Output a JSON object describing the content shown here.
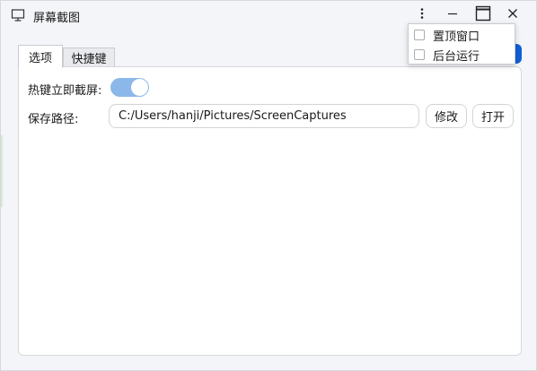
{
  "window": {
    "title": "屏幕截图",
    "app_icon": "monitor-icon"
  },
  "titlebar": {
    "menu_icon": "more-vertical-icon",
    "minimize_icon": "minimize-icon",
    "maximize_icon": "maximize-icon",
    "close_icon": "close-icon"
  },
  "tabs": [
    {
      "label": "选项",
      "active": true
    },
    {
      "label": "快捷键",
      "active": false
    }
  ],
  "options": {
    "hotkey_capture_label": "热键立即截屏:",
    "hotkey_capture_enabled": true,
    "save_path_label": "保存路径:",
    "save_path_value": "C:/Users/hanji/Pictures/ScreenCaptures",
    "edit_button": "修改",
    "open_button": "打开"
  },
  "dropdown": {
    "items": [
      {
        "label": "置顶窗口",
        "checked": false
      },
      {
        "label": "后台运行",
        "checked": false
      }
    ]
  },
  "colors": {
    "accent": "#1160d8",
    "toggle_on": "#8cb7ea"
  }
}
